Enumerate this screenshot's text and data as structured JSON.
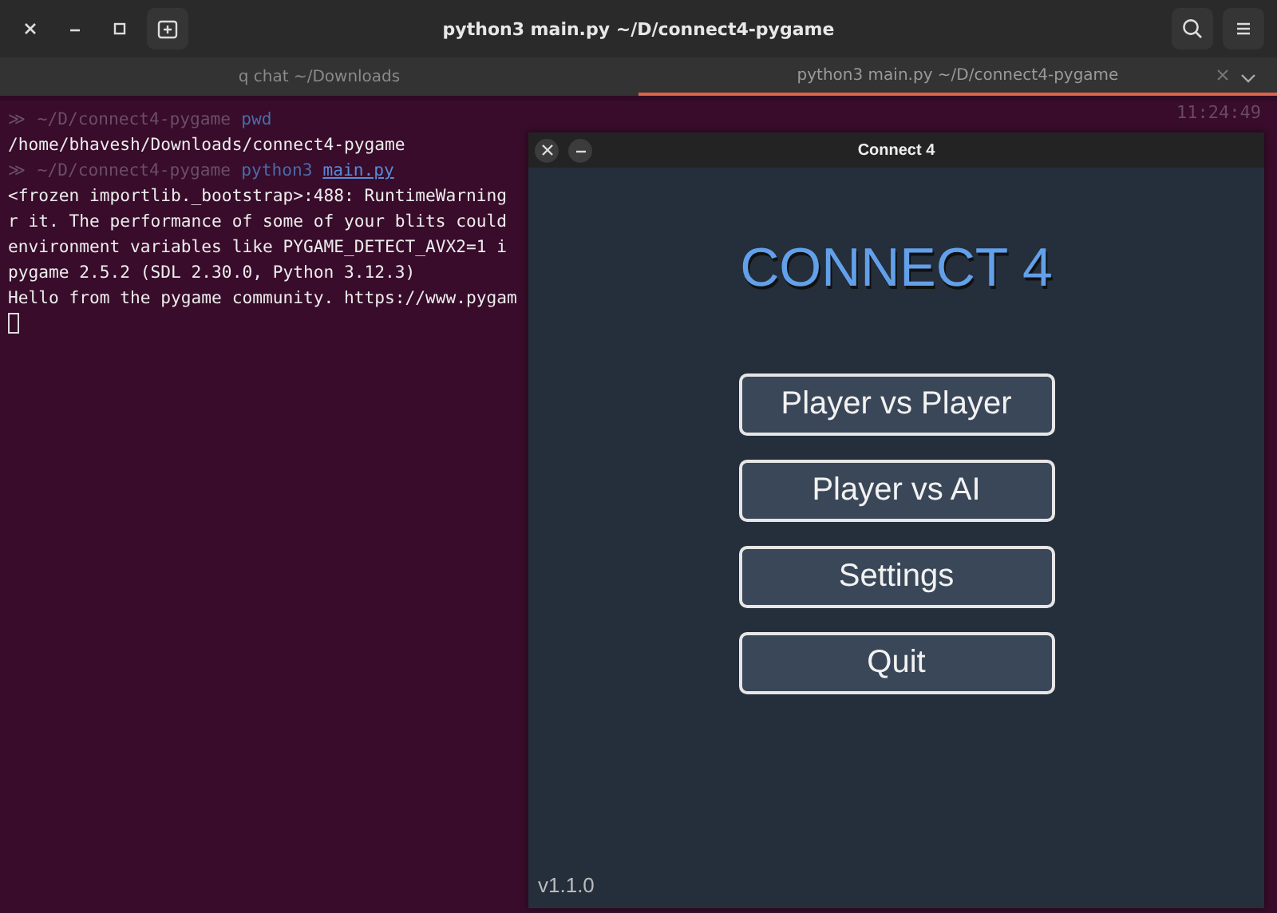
{
  "window": {
    "title": "python3 main.py ~/D/connect4-pygame"
  },
  "tabs": [
    {
      "label": "q chat ~/Downloads",
      "selected": false
    },
    {
      "label": "python3 main.py ~/D/connect4-pygame",
      "selected": true
    }
  ],
  "terminal": {
    "clock": "11:24:49",
    "lines": [
      [
        {
          "kind": "prompt",
          "text": "≫ ~/D/connect4-pygame"
        },
        {
          "kind": "command",
          "text": "pwd"
        }
      ],
      [
        {
          "kind": "output",
          "text": "/home/bhavesh/Downloads/connect4-pygame"
        }
      ],
      [
        {
          "kind": "prompt",
          "text": "≫ ~/D/connect4-pygame"
        },
        {
          "kind": "command",
          "text": "python3"
        },
        {
          "kind": "argument",
          "text": "main.py"
        }
      ],
      [
        {
          "kind": "output",
          "text": "<frozen importlib._bootstrap>:488: RuntimeWarning"
        }
      ],
      [
        {
          "kind": "output",
          "text": "r it. The performance of some of your blits could"
        }
      ],
      [
        {
          "kind": "output",
          "text": "environment variables like PYGAME_DETECT_AVX2=1 i"
        }
      ],
      [
        {
          "kind": "output",
          "text": "pygame 2.5.2 (SDL 2.30.0, Python 3.12.3)"
        }
      ],
      [
        {
          "kind": "output",
          "text": "Hello from the pygame community. https://www.pygam"
        }
      ]
    ]
  },
  "game_window": {
    "title": "Connect 4",
    "heading": "CONNECT 4",
    "buttons": [
      "Player vs Player",
      "Player vs AI",
      "Settings",
      "Quit"
    ],
    "version": "v1.1.0"
  }
}
